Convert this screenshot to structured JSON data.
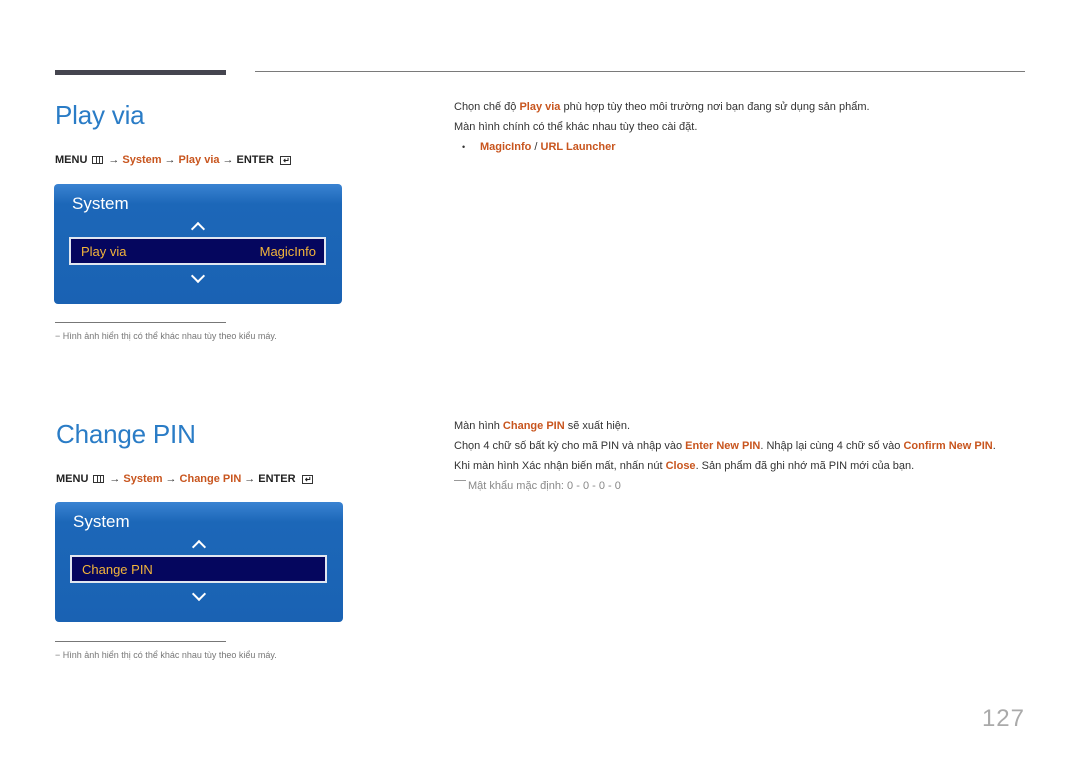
{
  "page_number": "127",
  "sections": [
    {
      "title": "Play via",
      "menu_path": {
        "menu": "MENU",
        "system": "System",
        "item": "Play via",
        "enter": "ENTER",
        "arrow": "→"
      },
      "osd": {
        "title": "System",
        "row_label": "Play via",
        "row_value": "MagicInfo"
      },
      "note": "−  Hình ảnh hiển thị có thể khác nhau tùy theo kiểu máy.",
      "description": {
        "line1_pre": "Chọn chế độ ",
        "line1_hl": "Play via",
        "line1_post": " phù hợp tùy theo môi trường nơi bạn đang sử dụng sản phẩm.",
        "line2": "Màn hình chính có thể khác nhau tùy theo cài đặt.",
        "bullet_mark": "•",
        "bullet_opt1": "MagicInfo",
        "bullet_sep": " / ",
        "bullet_opt2": "URL Launcher"
      }
    },
    {
      "title": "Change PIN",
      "menu_path": {
        "menu": "MENU",
        "system": "System",
        "item": "Change PIN",
        "enter": "ENTER",
        "arrow": "→"
      },
      "osd": {
        "title": "System",
        "row_label": "Change PIN",
        "row_value": ""
      },
      "note": "−  Hình ảnh hiển thị có thể khác nhau tùy theo kiểu máy.",
      "description": {
        "line1_pre": "Màn hình ",
        "line1_hl": "Change PIN",
        "line1_post": " sẽ xuất hiện.",
        "line2_pre": "Chọn 4 chữ số bất kỳ cho mã PIN và nhập vào ",
        "line2_hl1": "Enter New PIN",
        "line2_mid": ". Nhập lại cùng 4 chữ số vào ",
        "line2_hl2": "Confirm New PIN",
        "line2_post": ".",
        "line3_pre": "Khi màn hình Xác nhận biến mất, nhấn nút ",
        "line3_hl": "Close",
        "line3_post": ". Sản phẩm đã ghi nhớ mã PIN mới của bạn.",
        "default_pin_note": "Mật khẩu mặc định: 0 - 0 - 0 - 0"
      }
    }
  ]
}
